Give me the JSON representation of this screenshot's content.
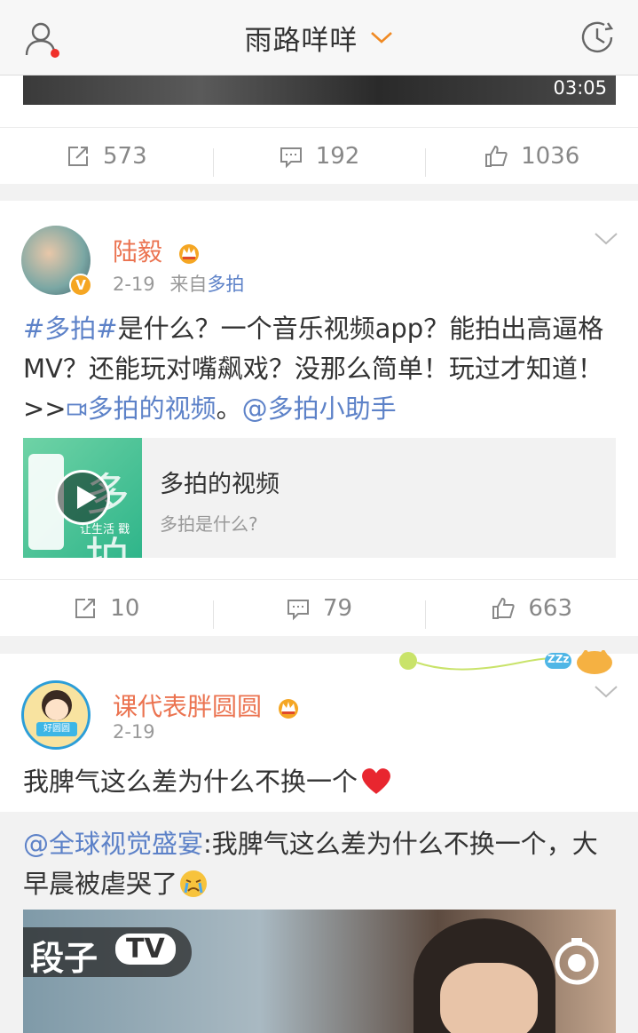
{
  "header": {
    "title": "雨路咩咩"
  },
  "top_video": {
    "duration": "03:05"
  },
  "post1": {
    "reposts": "573",
    "comments": "192",
    "likes": "1036"
  },
  "post2": {
    "author": "陆毅",
    "date": "2-19",
    "source_prefix": "来自",
    "source": "多拍",
    "text_tag": "#多拍#",
    "text_body": "是什么？一个音乐视频app？能拍出高逼格MV？还能玩对嘴飙戏？没那么简单！玩过才知道！>>",
    "text_video_link": "多拍的视频",
    "text_period": "。",
    "text_mention": "@多拍小助手",
    "card_title": "多拍的视频",
    "card_sub": "多拍是什么?",
    "thumb_text_big": "多拍",
    "thumb_text_small": "让生活 戳",
    "reposts": "10",
    "comments": "79",
    "likes": "663"
  },
  "post3": {
    "author": "课代表胖圆圆",
    "date": "2-19",
    "text": "我脾气这么差为什么不换一个",
    "repost_mention": "@全球视觉盛宴",
    "repost_text": ":我脾气这么差为什么不换一个，大早晨被虐哭了",
    "video_logo": "段子",
    "video_logo_tv": "TV",
    "avatar_label": "好圆圆",
    "zzz": "ZZz"
  },
  "colors": {
    "accent_orange": "#eb7350",
    "link_blue": "#5d82c8",
    "muted": "#999999"
  }
}
